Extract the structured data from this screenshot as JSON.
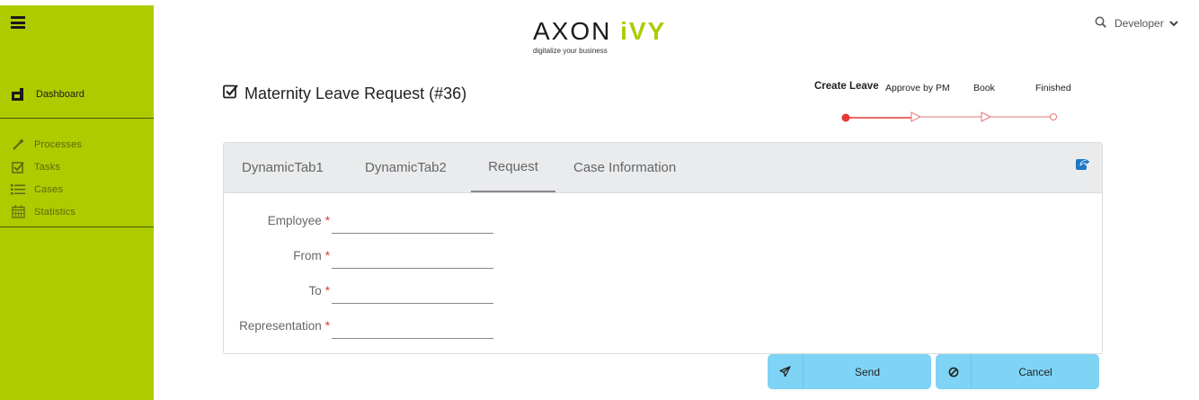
{
  "brand": {
    "name_part1": "AXON ",
    "name_part2": "iVY",
    "tagline": "digitalize your business",
    "accent_color": "#aecb00"
  },
  "header": {
    "user_name": "Developer"
  },
  "sidebar": {
    "dashboard_label": "Dashboard",
    "items": [
      {
        "icon": "magic-wand-icon",
        "label": "Processes"
      },
      {
        "icon": "checkbox-icon",
        "label": "Tasks"
      },
      {
        "icon": "list-icon",
        "label": "Cases"
      },
      {
        "icon": "calendar-icon",
        "label": "Statistics"
      }
    ]
  },
  "page": {
    "title": "Maternity Leave Request (#36)"
  },
  "stepper": {
    "steps": [
      "Create Leave",
      "Approve by PM",
      "Book",
      "Finished"
    ],
    "current_index": 0,
    "active_color": "#e53935"
  },
  "tabs": [
    {
      "label": "DynamicTab1"
    },
    {
      "label": "DynamicTab2"
    },
    {
      "label": "Request"
    },
    {
      "label": "Case Information"
    }
  ],
  "active_tab": "Request",
  "form": {
    "fields": [
      {
        "label": "Employee",
        "required_mark": "*",
        "value": ""
      },
      {
        "label": "From",
        "required_mark": "*",
        "value": ""
      },
      {
        "label": "To",
        "required_mark": "*",
        "value": ""
      },
      {
        "label": "Representation",
        "required_mark": "*",
        "value": ""
      }
    ]
  },
  "actions": {
    "send_label": "Send",
    "cancel_label": "Cancel",
    "button_color": "#7fd4f5"
  }
}
